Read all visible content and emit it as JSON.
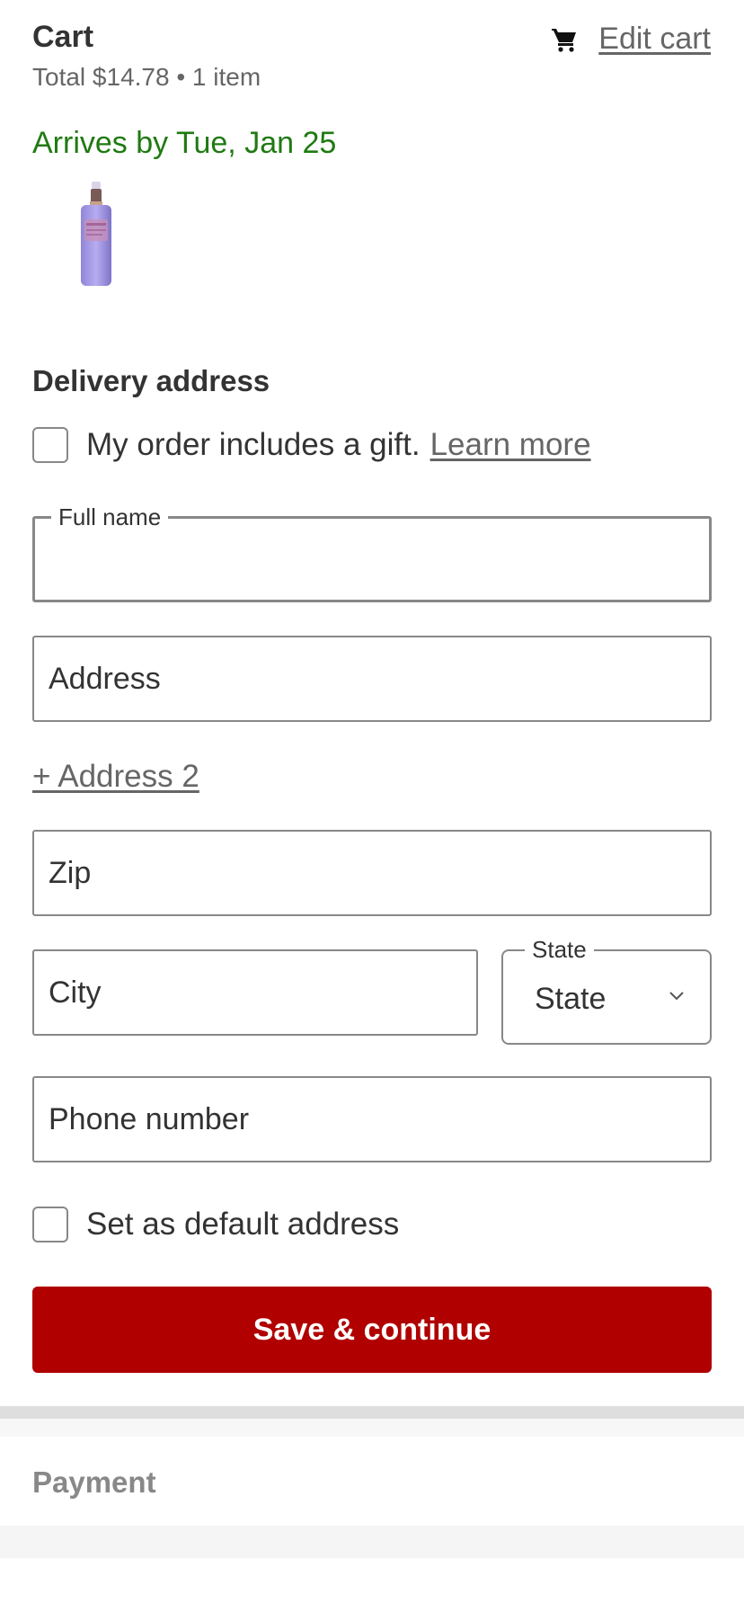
{
  "header": {
    "title": "Cart",
    "summary": "Total $14.78 • 1 item",
    "edit_cart_label": "Edit cart",
    "cart_icon": "shopping-cart-icon"
  },
  "delivery_estimate": "Arrives by Tue, Jan 25",
  "delivery_section": {
    "heading": "Delivery address",
    "gift_label": "My order includes a gift.",
    "learn_more": "Learn more",
    "full_name_label": "Full name",
    "full_name_value": "",
    "address_placeholder": "Address",
    "address2_link": "+ Address 2",
    "zip_placeholder": "Zip",
    "city_placeholder": "City",
    "state_label": "State",
    "state_value": "State",
    "phone_placeholder": "Phone number",
    "default_label": "Set as default address",
    "save_button": "Save & continue"
  },
  "payment_section": {
    "title": "Payment"
  },
  "colors": {
    "accent_red": "#b00000",
    "arrival_green": "#1f7a11"
  }
}
